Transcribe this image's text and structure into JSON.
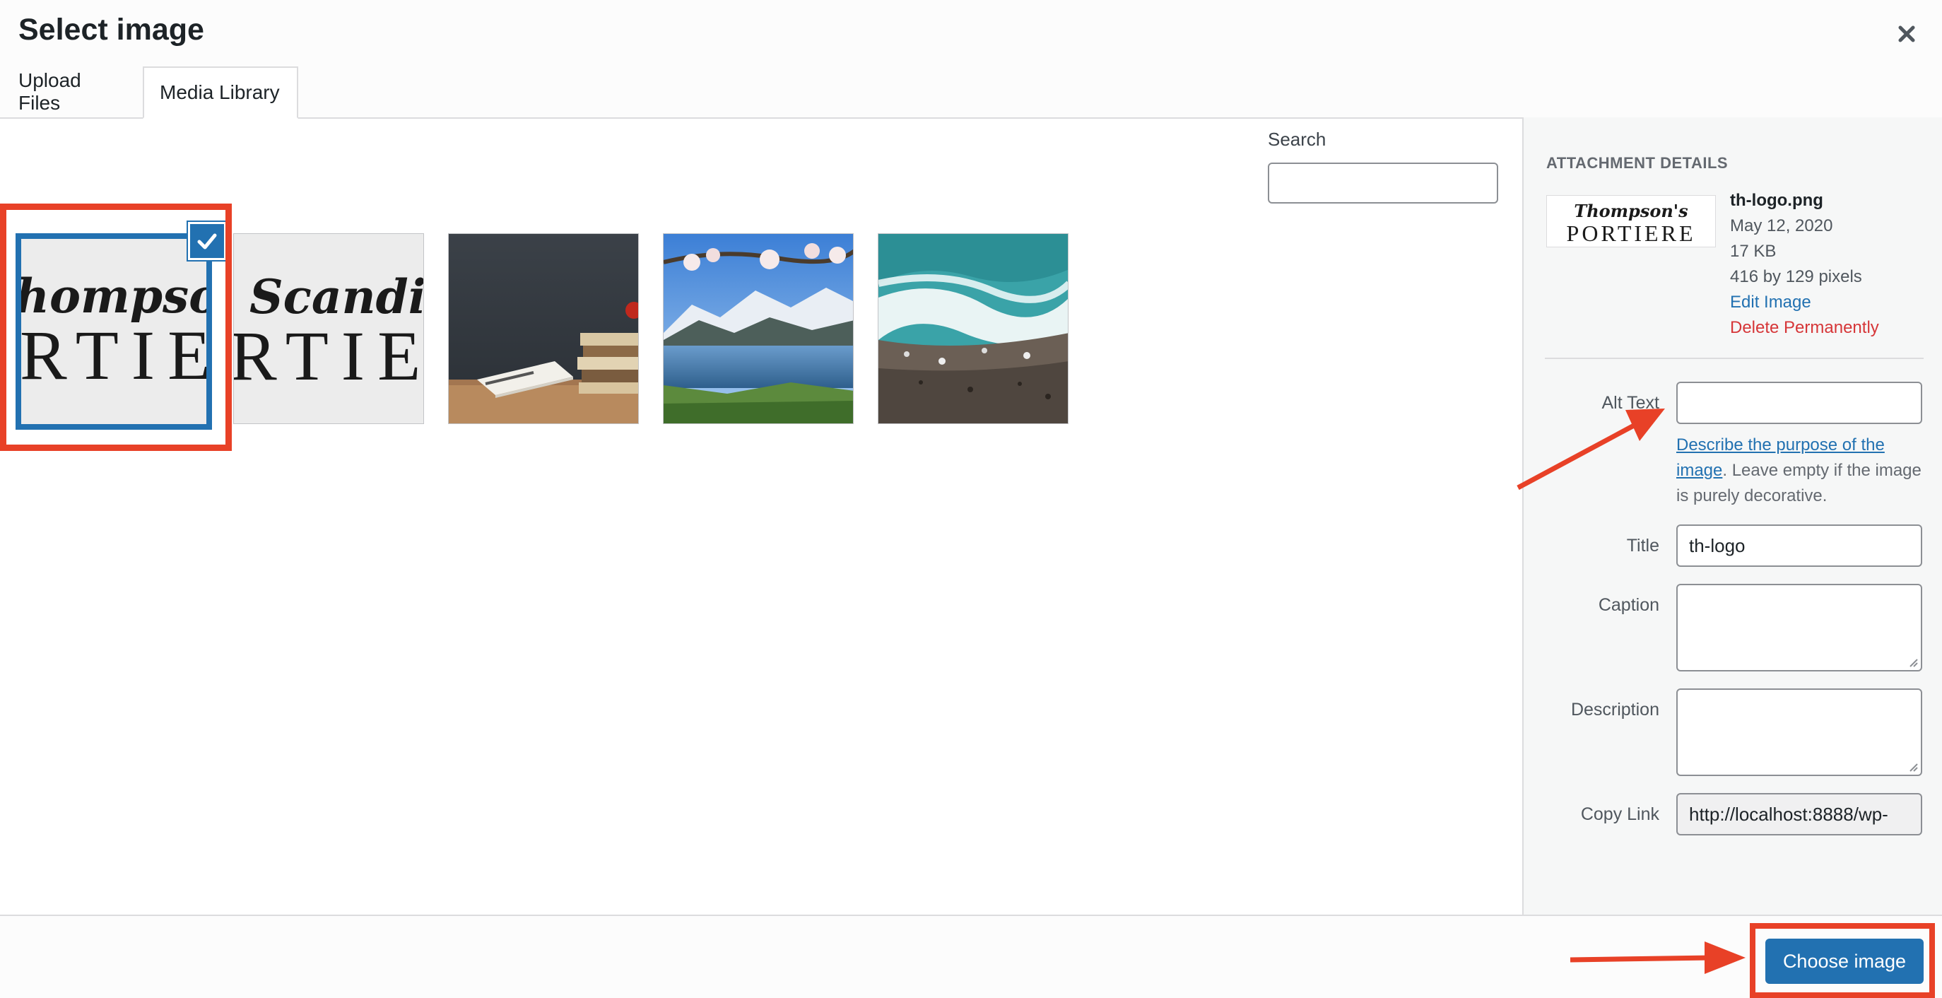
{
  "modal": {
    "title": "Select image"
  },
  "tabs": [
    {
      "label": "Upload Files",
      "active": false
    },
    {
      "label": "Media Library",
      "active": true
    }
  ],
  "search": {
    "label": "Search",
    "value": ""
  },
  "library": {
    "items": [
      {
        "name": "thompsons-portiere-logo",
        "text_line1": "hompson'",
        "text_line2": "RTIE",
        "selected": true
      },
      {
        "name": "scandi-portiere-logo",
        "text_line1": "Scandi",
        "text_line2": "RTIE",
        "selected": false
      },
      {
        "name": "books-notebook-photo",
        "selected": false
      },
      {
        "name": "fjord-landscape-photo",
        "selected": false
      },
      {
        "name": "ocean-waves-aerial-photo",
        "selected": false
      }
    ]
  },
  "details": {
    "heading": "ATTACHMENT DETAILS",
    "thumbnail_text_line1": "Thompson's",
    "thumbnail_text_line2": "PORTIERE",
    "filename": "th-logo.png",
    "date": "May 12, 2020",
    "filesize": "17 KB",
    "dimensions": "416 by 129 pixels",
    "edit_link": "Edit Image",
    "delete_link": "Delete Permanently"
  },
  "fields": {
    "alt_text": {
      "label": "Alt Text",
      "value": ""
    },
    "alt_help_link": "Describe the purpose of the image",
    "alt_help_rest": ". Leave empty if the image is purely decorative.",
    "title": {
      "label": "Title",
      "value": "th-logo"
    },
    "caption": {
      "label": "Caption",
      "value": ""
    },
    "description": {
      "label": "Description",
      "value": ""
    },
    "copy_link": {
      "label": "Copy Link",
      "value": "http://localhost:8888/wp-"
    }
  },
  "footer": {
    "choose_button": "Choose image"
  },
  "colors": {
    "accent": "#2271b1",
    "annotation": "#e84127",
    "danger": "#d63638"
  },
  "icons": [
    "close-icon",
    "checkmark-icon",
    "resize-handle-icon"
  ]
}
